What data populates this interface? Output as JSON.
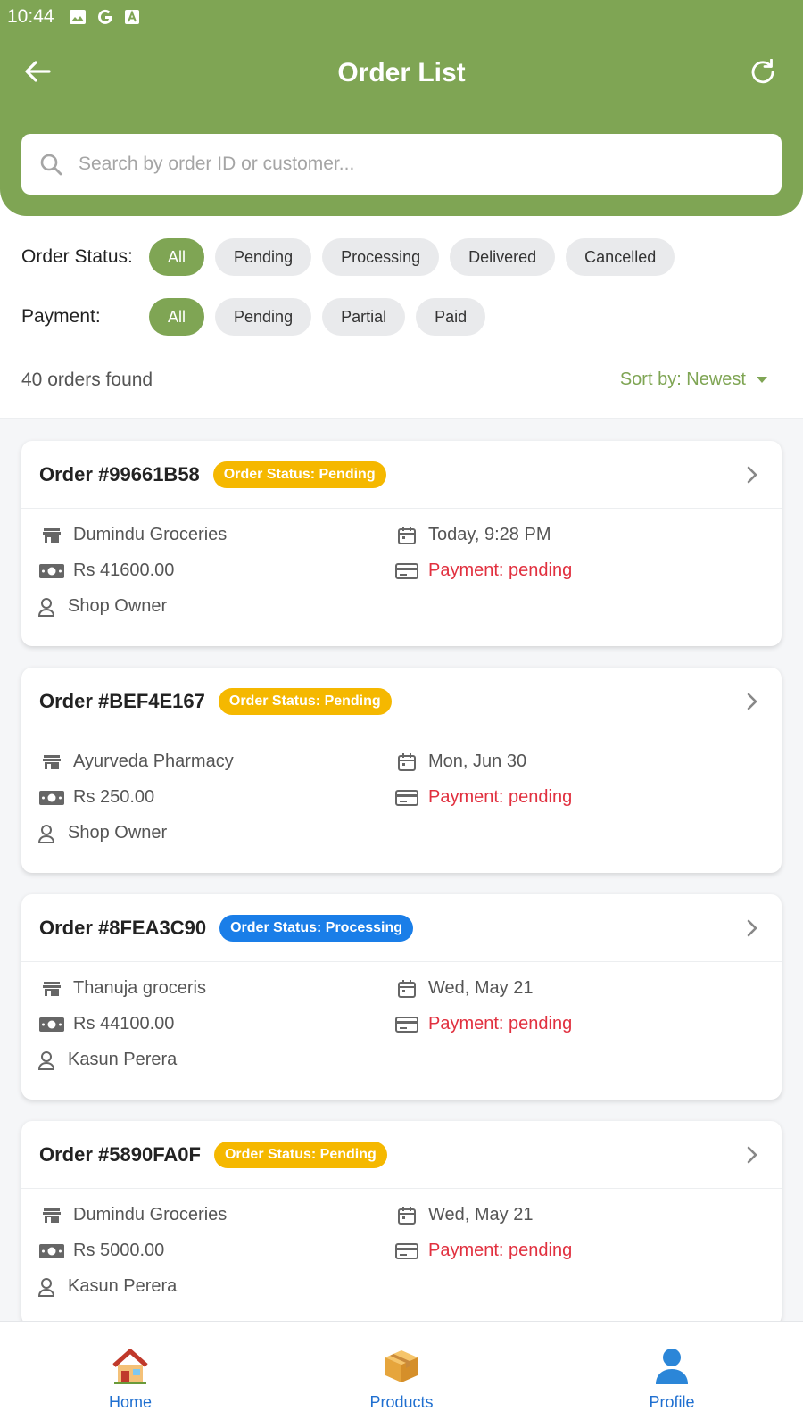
{
  "statusbar": {
    "time": "10:44"
  },
  "header": {
    "title": "Order List"
  },
  "search": {
    "placeholder": "Search by order ID or customer..."
  },
  "filters": {
    "order_status": {
      "label": "Order Status:",
      "options": [
        "All",
        "Pending",
        "Processing",
        "Delivered",
        "Cancelled"
      ],
      "selected": "All"
    },
    "payment": {
      "label": "Payment:",
      "options": [
        "All",
        "Pending",
        "Partial",
        "Paid"
      ],
      "selected": "All"
    }
  },
  "results": {
    "count_text": "40 orders found",
    "sort_label": "Sort by: Newest"
  },
  "orders": [
    {
      "id": "Order #99661B58",
      "status": "Order Status: Pending",
      "status_color": "#f5b800",
      "shop": "Dumindu Groceries",
      "date": "Today, 9:28 PM",
      "amount": "Rs 41600.00",
      "payment": "Payment: pending",
      "customer": "Shop Owner"
    },
    {
      "id": "Order #BEF4E167",
      "status": "Order Status: Pending",
      "status_color": "#f5b800",
      "shop": "Ayurveda Pharmacy",
      "date": "Mon, Jun 30",
      "amount": "Rs 250.00",
      "payment": "Payment: pending",
      "customer": "Shop Owner"
    },
    {
      "id": "Order #8FEA3C90",
      "status": "Order Status: Processing",
      "status_color": "#1a7ee8",
      "shop": "Thanuja groceris",
      "date": "Wed, May 21",
      "amount": "Rs 44100.00",
      "payment": "Payment: pending",
      "customer": "Kasun Perera"
    },
    {
      "id": "Order #5890FA0F",
      "status": "Order Status: Pending",
      "status_color": "#f5b800",
      "shop": "Dumindu Groceries",
      "date": "Wed, May 21",
      "amount": "Rs 5000.00",
      "payment": "Payment: pending",
      "customer": "Kasun Perera"
    }
  ],
  "colors": {
    "brand": "#7fa554",
    "payment_pending": "#e1303f",
    "nav_label": "#1f6fd0"
  },
  "bottom_nav": [
    {
      "label": "Home",
      "icon": "house-icon"
    },
    {
      "label": "Products",
      "icon": "package-icon"
    },
    {
      "label": "Profile",
      "icon": "person-icon"
    }
  ]
}
